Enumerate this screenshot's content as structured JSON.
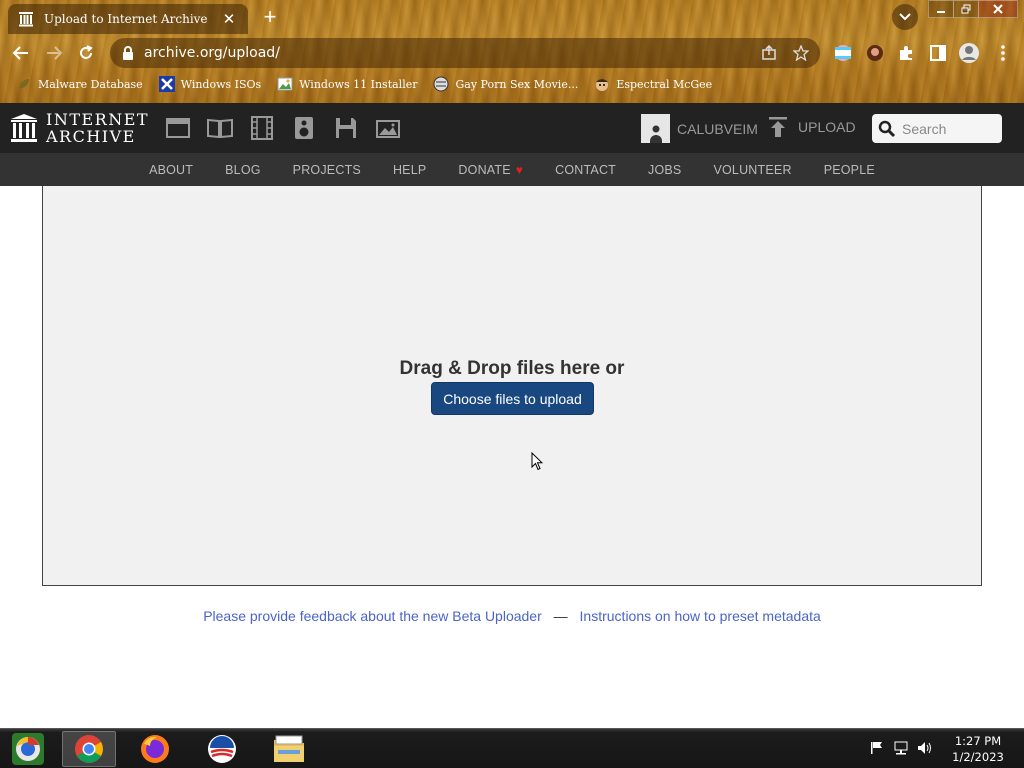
{
  "browser": {
    "tab_title": "Upload to Internet Archive",
    "tab_close": "✕",
    "new_tab": "+",
    "url": "archive.org/upload/",
    "bookmarks": [
      {
        "label": "Malware Database"
      },
      {
        "label": "Windows ISOs"
      },
      {
        "label": "Windows 11 Installer"
      },
      {
        "label": "Gay Porn Sex Movie..."
      },
      {
        "label": "Espectral McGee"
      }
    ]
  },
  "ia_header": {
    "logo_line1": "INTERNET",
    "logo_line2": "ARCHIVE",
    "media_icons": [
      "web-icon",
      "texts-icon",
      "video-icon",
      "audio-icon",
      "software-icon",
      "images-icon"
    ],
    "username": "CALUBVEIM",
    "upload_label": "UPLOAD",
    "search_placeholder": "Search"
  },
  "ia_nav": {
    "items": [
      "ABOUT",
      "BLOG",
      "PROJECTS",
      "HELP",
      "DONATE",
      "CONTACT",
      "JOBS",
      "VOLUNTEER",
      "PEOPLE"
    ],
    "donate_heart": "♥"
  },
  "upload": {
    "drop_text": "Drag & Drop files here or",
    "choose_button": "Choose files to upload"
  },
  "feedback": {
    "link1": "Please provide feedback about the new Beta Uploader",
    "separator": "—",
    "link2": "Instructions on how to preset metadata"
  },
  "taskbar": {
    "time": "1:27 PM",
    "date": "1/2/2023"
  },
  "colors": {
    "ia_dark": "#222222",
    "ia_nav": "#333333",
    "button_blue": "#194880",
    "link_blue": "#4b64c8",
    "heart_red": "#e02020"
  }
}
